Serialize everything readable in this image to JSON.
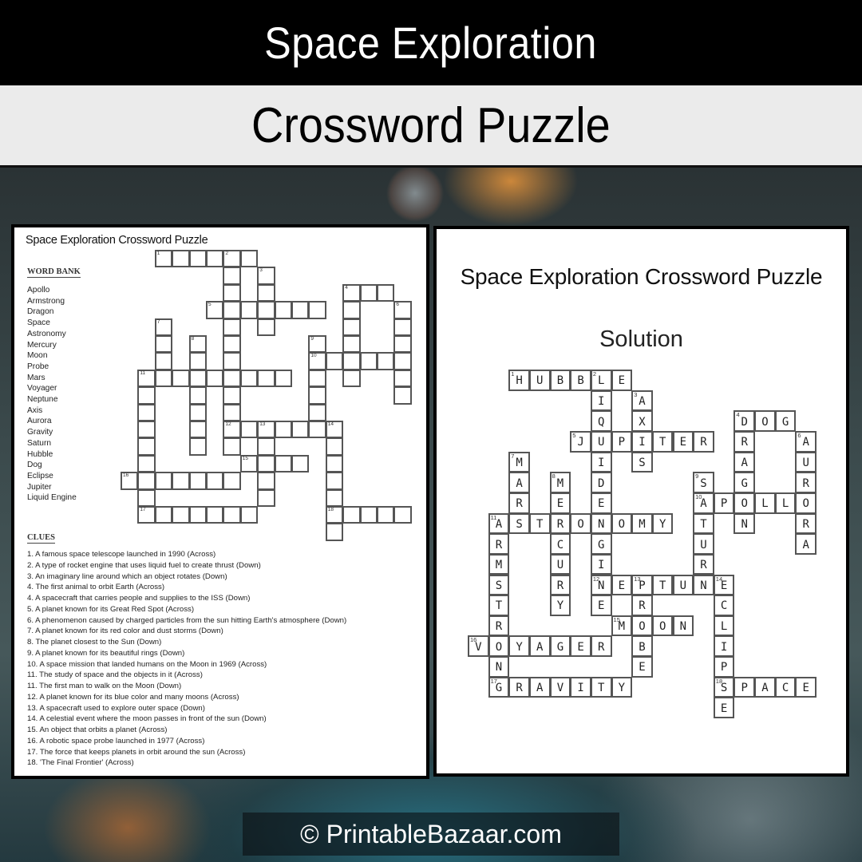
{
  "header": {
    "title": "Space Exploration",
    "subtitle": "Crossword Puzzle"
  },
  "puzzle": {
    "title": "Space Exploration Crossword Puzzle",
    "word_bank_heading": "WORD BANK",
    "word_bank": [
      "Apollo",
      "Armstrong",
      "Dragon",
      "Space",
      "Astronomy",
      "Mercury",
      "Moon",
      "Probe",
      "Mars",
      "Voyager",
      "Neptune",
      "Axis",
      "Aurora",
      "Gravity",
      "Saturn",
      "Hubble",
      "Dog",
      "Eclipse",
      "Jupiter",
      "Liquid Engine"
    ],
    "clues_heading": "CLUES",
    "clues": [
      "1. A famous space telescope launched in 1990 (Across)",
      "2. A type of rocket  engine that uses liquid fuel to create thrust (Down)",
      "3. An imaginary line around  which  an object rotates (Down)",
      "4. The first animal to orbit  Earth (Across)",
      "4. A spacecraft that carries people and supplies to the ISS (Down)",
      "5. A planet known  for its Great Red Spot (Across)",
      "6. A phenomenon  caused by charged particles from the sun hitting Earth's atmosphere (Down)",
      "7. A planet known  for its red color and dust storms (Down)",
      "8. The planet closest to the Sun (Down)",
      "9. A planet known  for its beautiful rings (Down)",
      "10. A space mission that landed humans  on the Moon  in 1969 (Across)",
      "11. The study of space and the objects in it (Across)",
      "11. The first man to walk on the Moon  (Down)",
      "12. A planet known  for its blue color and many moons  (Across)",
      "13. A spacecraft used to explore outer space (Down)",
      "14. A celestial event where the moon  passes in front of the sun (Down)",
      "15. An object that orbits a planet (Across)",
      "16. A robotic space probe launched in 1977 (Across)",
      "17. The force that keeps planets in orbit around the sun (Across)",
      "18. 'The Final Frontier'  (Across)"
    ]
  },
  "solution": {
    "title": "Space Exploration Crossword Puzzle",
    "subtitle": "Solution"
  },
  "crossword": {
    "entries": [
      {
        "num": 1,
        "dir": "across",
        "row": 0,
        "col": 2,
        "answer": "HUBBLE"
      },
      {
        "num": 2,
        "dir": "down",
        "row": 0,
        "col": 6,
        "answer": "LIQUIDENGINE"
      },
      {
        "num": 3,
        "dir": "down",
        "row": 1,
        "col": 8,
        "answer": "AXIS"
      },
      {
        "num": 4,
        "dir": "across",
        "row": 2,
        "col": 13,
        "answer": "DOG"
      },
      {
        "num": 4,
        "dir": "down",
        "row": 2,
        "col": 13,
        "answer": "DRAGON"
      },
      {
        "num": 5,
        "dir": "across",
        "row": 3,
        "col": 5,
        "answer": "JUPITER"
      },
      {
        "num": 6,
        "dir": "down",
        "row": 3,
        "col": 16,
        "answer": "AURORA"
      },
      {
        "num": 7,
        "dir": "down",
        "row": 4,
        "col": 2,
        "answer": "MARS"
      },
      {
        "num": 8,
        "dir": "down",
        "row": 5,
        "col": 4,
        "answer": "MERCURY"
      },
      {
        "num": 9,
        "dir": "down",
        "row": 5,
        "col": 11,
        "answer": "SATURN"
      },
      {
        "num": 10,
        "dir": "across",
        "row": 6,
        "col": 11,
        "answer": "APOLLO"
      },
      {
        "num": 11,
        "dir": "across",
        "row": 7,
        "col": 1,
        "answer": "ASTRONOMY"
      },
      {
        "num": 11,
        "dir": "down",
        "row": 7,
        "col": 1,
        "answer": "ARMSTRONG"
      },
      {
        "num": 12,
        "dir": "across",
        "row": 10,
        "col": 6,
        "answer": "NEPTUNE"
      },
      {
        "num": 13,
        "dir": "down",
        "row": 10,
        "col": 8,
        "answer": "PROBE"
      },
      {
        "num": 14,
        "dir": "down",
        "row": 10,
        "col": 12,
        "answer": "ECLIPSE"
      },
      {
        "num": 15,
        "dir": "across",
        "row": 12,
        "col": 7,
        "answer": "MOON"
      },
      {
        "num": 16,
        "dir": "across",
        "row": 13,
        "col": 0,
        "answer": "VOYAGER"
      },
      {
        "num": 17,
        "dir": "across",
        "row": 15,
        "col": 1,
        "answer": "GRAVITY"
      },
      {
        "num": 18,
        "dir": "across",
        "row": 15,
        "col": 12,
        "answer": "SPACE"
      }
    ]
  },
  "footer": {
    "copyright": "© PrintableBazaar.com"
  }
}
